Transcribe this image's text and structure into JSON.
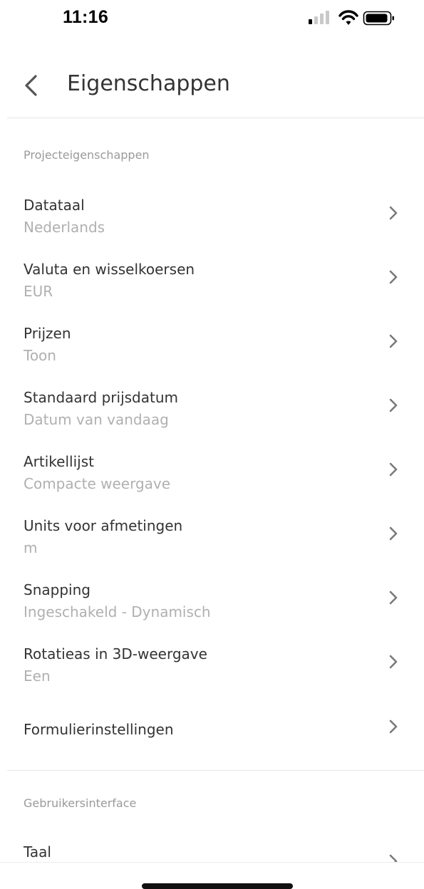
{
  "status_bar": {
    "time": "11:16"
  },
  "header": {
    "title": "Eigenschappen",
    "back_icon": "chevron-left-icon"
  },
  "sections": [
    {
      "label": "Projecteigenschappen",
      "items": [
        {
          "label": "Datataal",
          "value": "Nederlands"
        },
        {
          "label": "Valuta en wisselkoersen",
          "value": "EUR"
        },
        {
          "label": "Prijzen",
          "value": "Toon"
        },
        {
          "label": "Standaard prijsdatum",
          "value": "Datum van vandaag"
        },
        {
          "label": "Artikellijst",
          "value": "Compacte weergave"
        },
        {
          "label": "Units voor afmetingen",
          "value": "m"
        },
        {
          "label": "Snapping",
          "value": "Ingeschakeld - Dynamisch"
        },
        {
          "label": "Rotatieas in 3D-weergave",
          "value": "Een"
        },
        {
          "label": "Formulierinstellingen",
          "value": ""
        }
      ]
    },
    {
      "label": "Gebruikersinterface",
      "items": [
        {
          "label": "Taal",
          "value": ""
        }
      ]
    }
  ],
  "colors": {
    "title": "#333333",
    "label": "#333333",
    "value": "#b0b0b0",
    "section_label": "#9a9a9a",
    "chevron": "#7a7a7a",
    "divider": "#e6e6e6"
  }
}
